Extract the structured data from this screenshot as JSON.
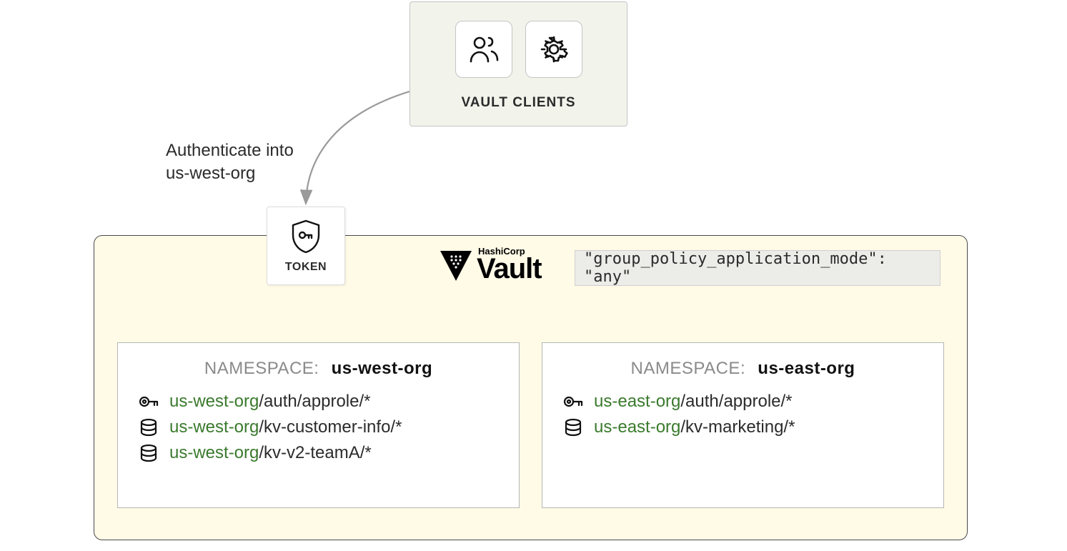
{
  "clients": {
    "label": "VAULT CLIENTS",
    "icons": [
      "user-icon",
      "gear-icon"
    ]
  },
  "auth_text_line1": "Authenticate into",
  "auth_text_line2": "us-west-org",
  "token_label": "TOKEN",
  "vault_logo": {
    "brand_small": "HashiCorp",
    "brand_large": "Vault"
  },
  "policy_setting": "\"group_policy_application_mode\": \"any\"",
  "namespace_label": "NAMESPACE:",
  "ns_west": {
    "name": "us-west-org",
    "rows": [
      {
        "icon": "key-icon",
        "prefix": "us-west-org",
        "suffix": "/auth/approle/*"
      },
      {
        "icon": "database-icon",
        "prefix": "us-west-org",
        "suffix": "/kv-customer-info/*"
      },
      {
        "icon": "database-icon",
        "prefix": "us-west-org",
        "suffix": "/kv-v2-teamA/*"
      }
    ]
  },
  "ns_east": {
    "name": "us-east-org",
    "rows": [
      {
        "icon": "key-icon",
        "prefix": "us-east-org",
        "suffix": "/auth/approle/*"
      },
      {
        "icon": "database-icon",
        "prefix": "us-east-org",
        "suffix": "/kv-marketing/*"
      }
    ]
  }
}
